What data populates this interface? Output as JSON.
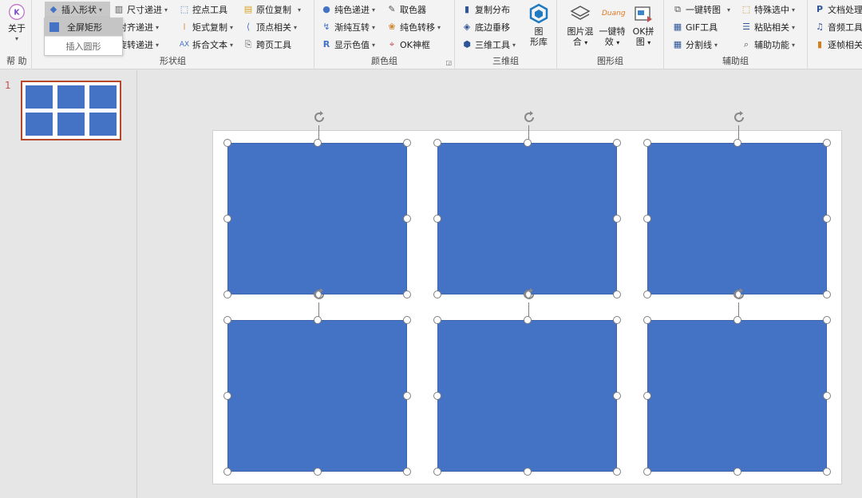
{
  "ribbon": {
    "help": {
      "about_label": "关于",
      "group_label": "帮 助"
    },
    "shape_group": {
      "group_label": "形状组",
      "insert_shape": "插入形状",
      "size_step": "尺寸递进",
      "align_step": "对齐递进",
      "rotate_step": "旋转递进",
      "ctrl_tool": "控点工具",
      "rect_copy": "矩式复制",
      "split_text": "拆合文本",
      "orig_copy": "原位复制",
      "vertex": "顶点相关",
      "cross_page": "跨页工具"
    },
    "color_group": {
      "group_label": "颜色组",
      "solid_step": "纯色递进",
      "gradient_swap": "渐纯互转",
      "show_color": "显示色值",
      "picker": "取色器",
      "solid_transfer": "纯色转移",
      "ok_frame": "OK神框"
    },
    "three_d_group": {
      "group_label": "三维组",
      "copy_distribute": "复制分布",
      "edge_move": "底边垂移",
      "three_d_tool": "三维工具",
      "shape_lib": "图\n形库"
    },
    "graphic_group": {
      "group_label": "图形组",
      "img_blend": "图片混\n合",
      "one_click_fx": "一键特\n效",
      "duang": "Duang",
      "ok_puzzle": "OK拼\n图"
    },
    "aux_group": {
      "group_label": "辅助组",
      "to_image": "一键转图",
      "gif_tool": "GIF工具",
      "split_line": "分割线",
      "special_select": "特殊选中",
      "paste_related": "粘贴相关",
      "aux_func": "辅助功能"
    },
    "extra": {
      "doc_process": "文档处理",
      "audio_tool": "音频工具",
      "frame_related": "逐帧相关"
    }
  },
  "dropdown": {
    "fullscreen_rect": "全屏矩形",
    "insert_circle": "插入圆形"
  },
  "thumbnails": {
    "slide_number": "1"
  },
  "colors": {
    "shape_fill": "#4472c4",
    "selection_accent": "#b7472a"
  }
}
